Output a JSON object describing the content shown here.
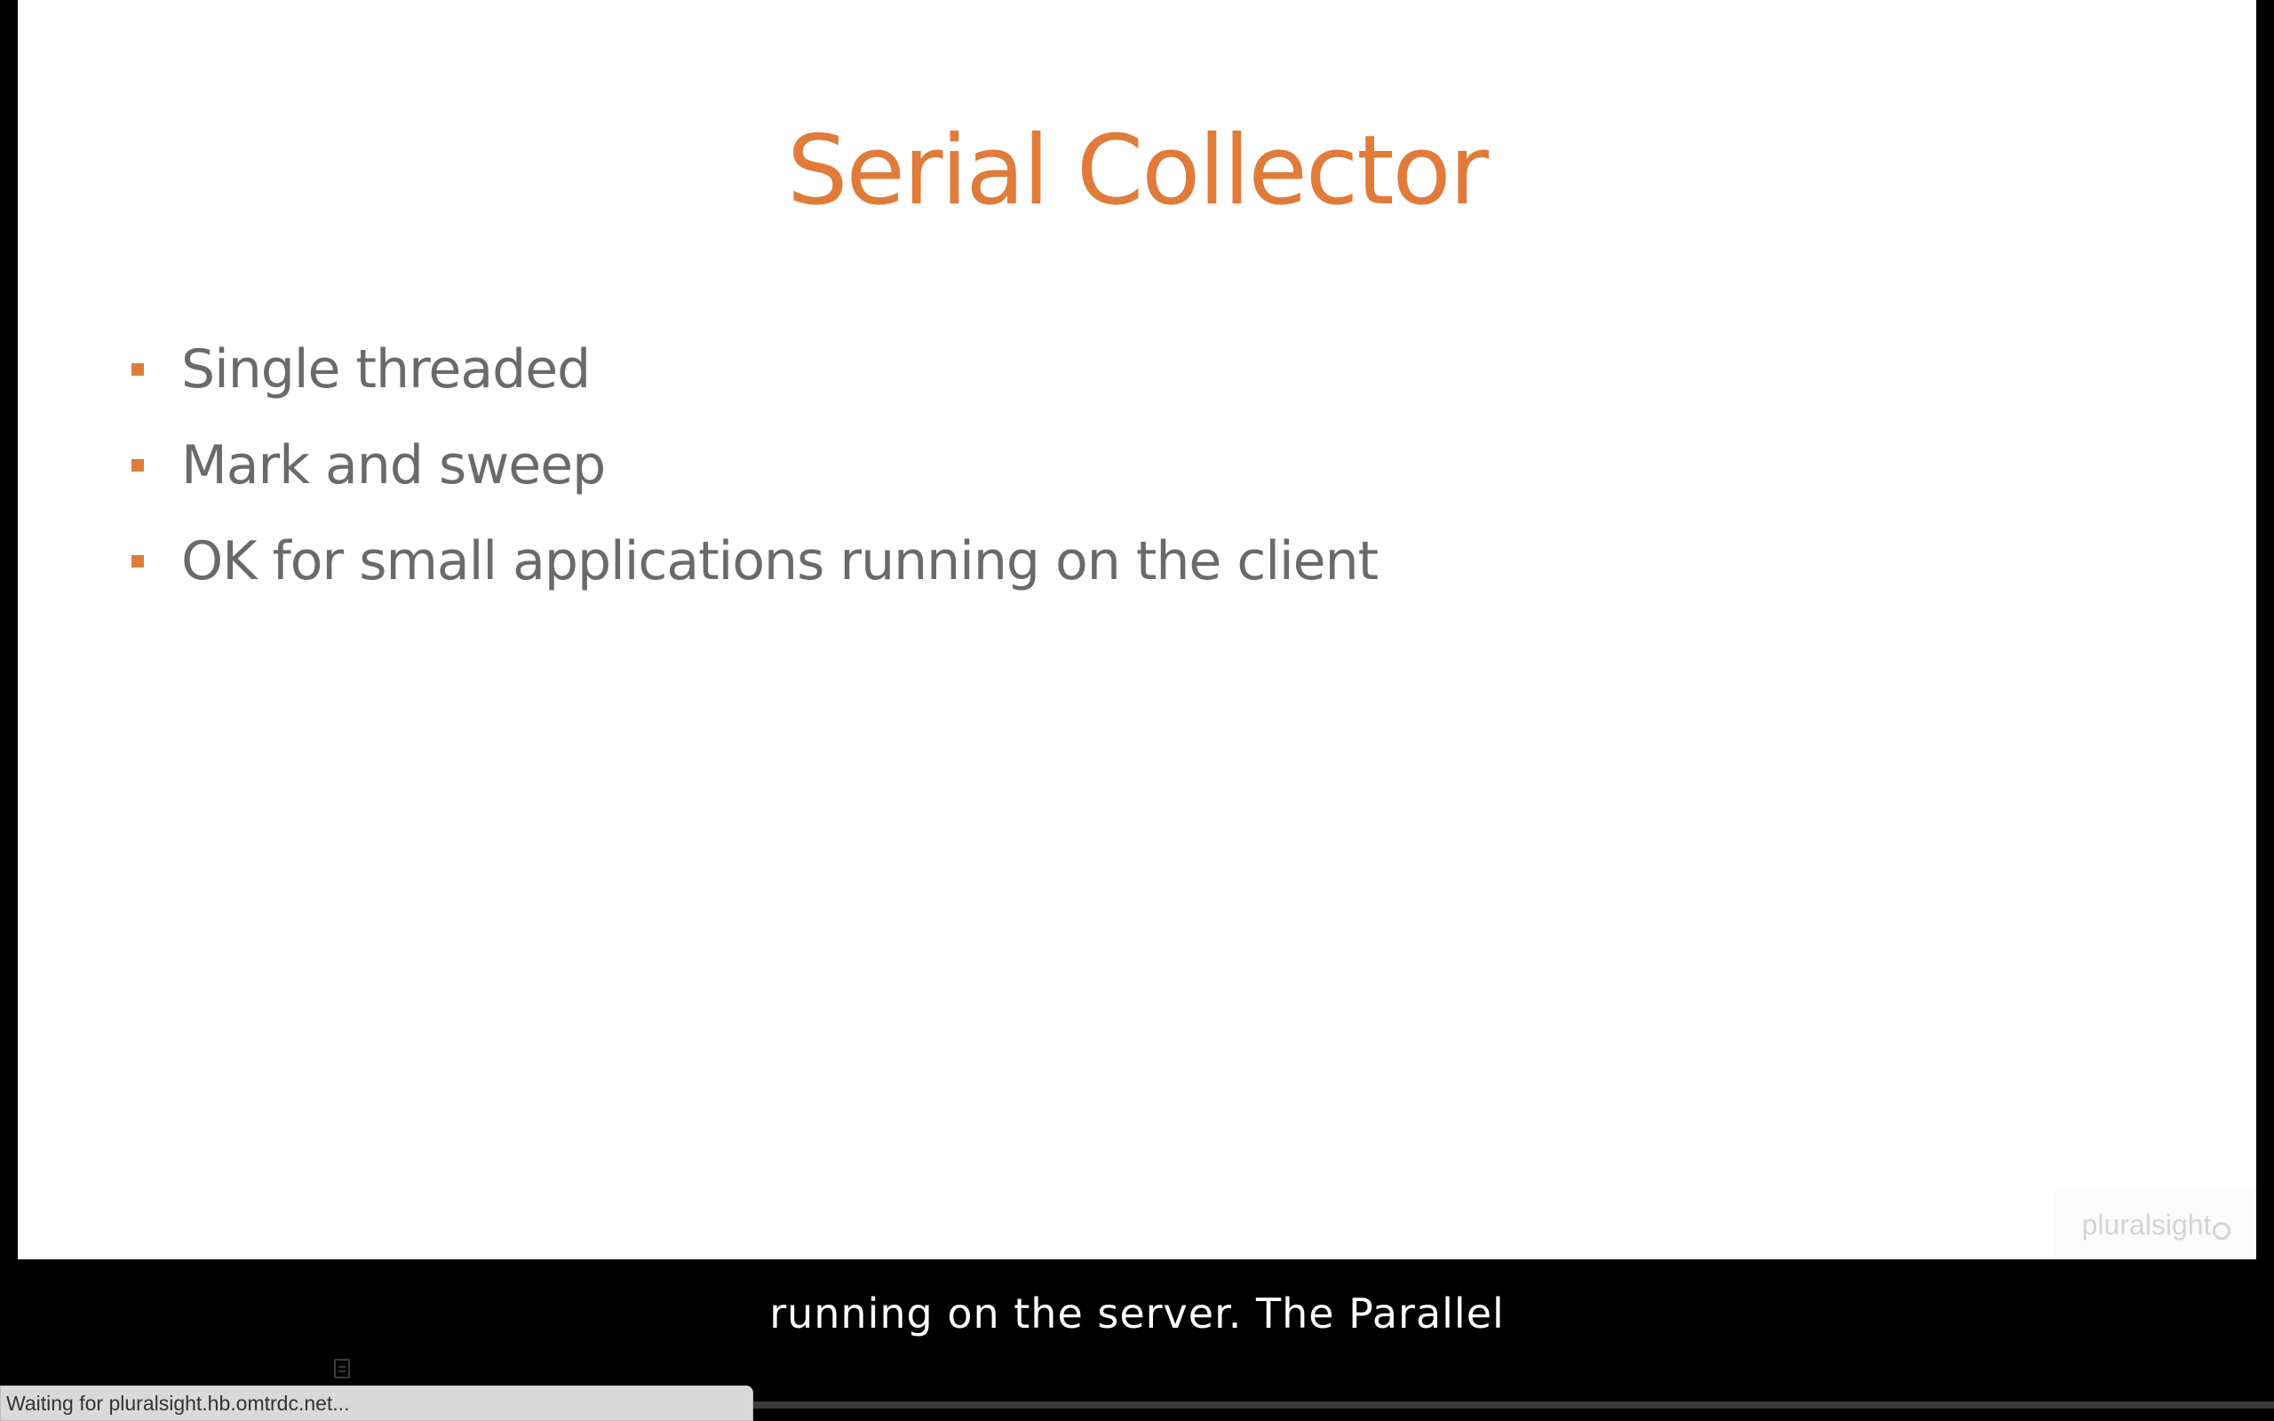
{
  "slide": {
    "title": "Serial Collector",
    "bullets": [
      "Single threaded",
      "Mark and sweep",
      "OK for small applications running on the client"
    ],
    "watermark": "pluralsight",
    "accent_color": "#e07b3a",
    "text_color": "#6a6a6a"
  },
  "player": {
    "caption": "running on the server. The Parallel",
    "progress": 0.14,
    "progress_color": "#f26b3a"
  },
  "browser": {
    "status_text": "Waiting for pluralsight.hb.omtrdc.net..."
  },
  "icons": {
    "transcript": "document-icon",
    "watermark": "pluralsight-logo-icon"
  }
}
